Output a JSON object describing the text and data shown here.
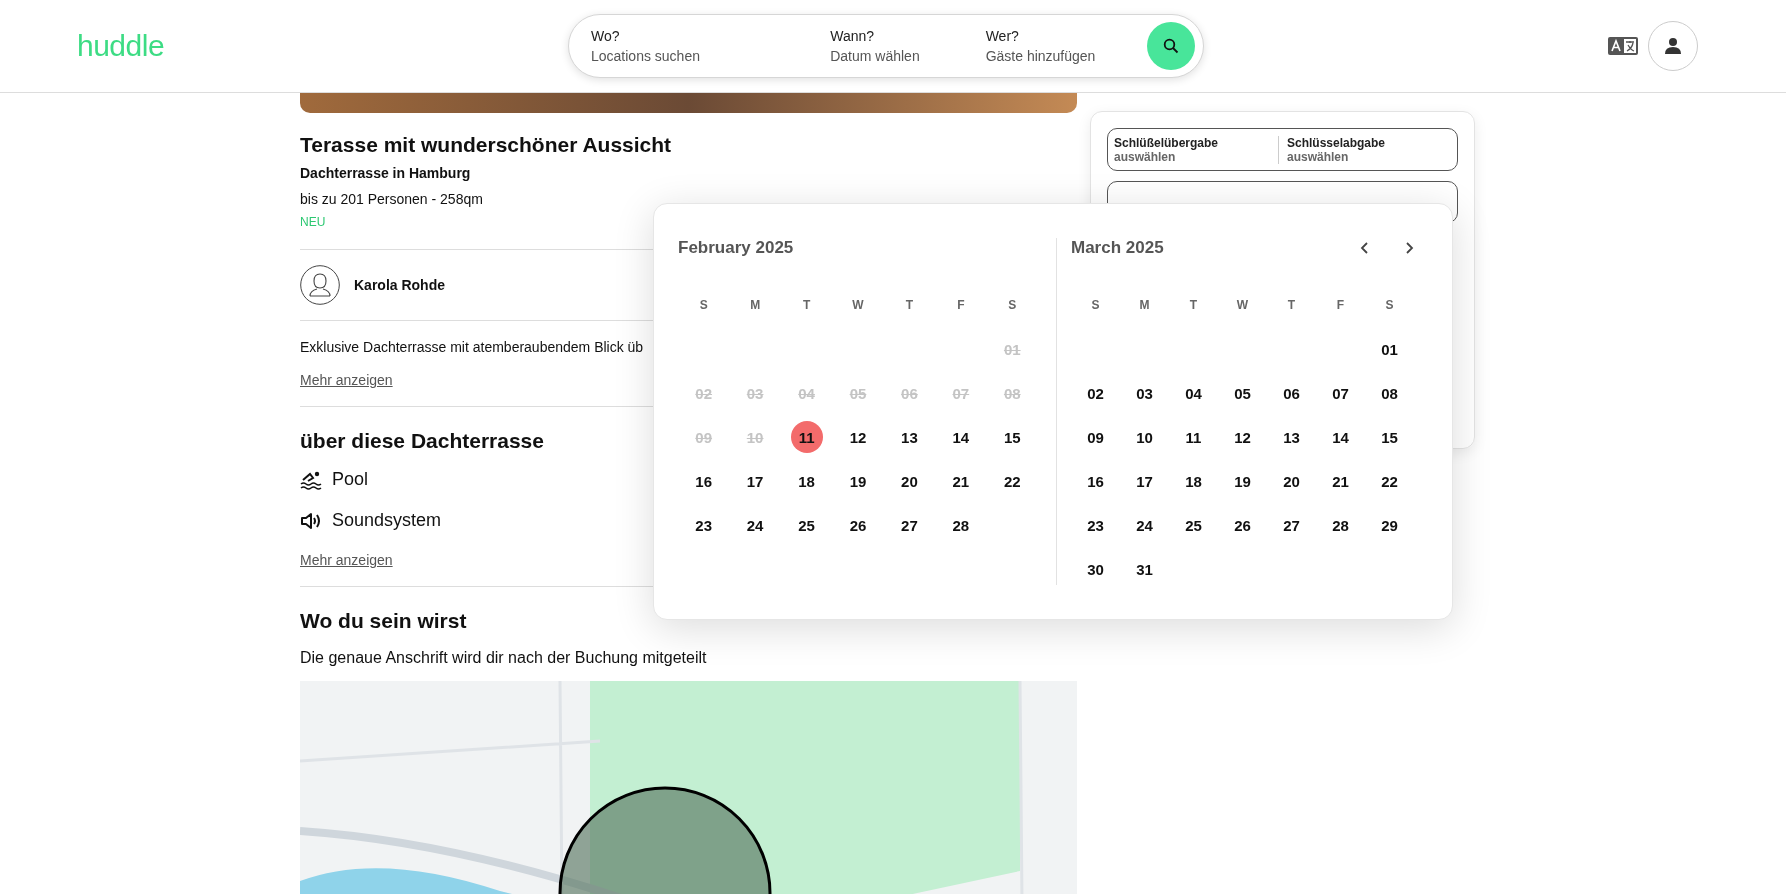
{
  "header": {
    "logo": "huddle",
    "search": [
      {
        "label": "Wo?",
        "placeholder": "Locations suchen"
      },
      {
        "label": "Wann?",
        "placeholder": "Datum wählen"
      },
      {
        "label": "Wer?",
        "placeholder": "Gäste hinzufügen"
      }
    ]
  },
  "listing": {
    "title": "Terasse mit wunderschöner Aussicht",
    "subtitle": "Dachterrasse in Hamburg",
    "capacity": "bis zu 201 Personen - 258qm",
    "badge": "NEU",
    "host": "Karola Rohde",
    "description": "Exklusive Dachterrasse mit atemberaubendem Blick üb",
    "more_1": "Mehr anzeigen",
    "amenities_title": "über diese Dachterrasse",
    "amenities": [
      {
        "kind": "pool",
        "label": "Pool"
      },
      {
        "kind": "sound",
        "label": "Soundsystem"
      }
    ],
    "more_2": "Mehr anzeigen",
    "location_title": "Wo du sein wirst",
    "location_note": "Die genaue Anschrift wird dir nach der Buchung mitgeteilt"
  },
  "booking": {
    "fields": [
      {
        "label": "Schlüßelübergabe",
        "value": "auswählen"
      },
      {
        "label": "Schlüsselabgabe",
        "value": "auswählen"
      }
    ]
  },
  "calendar": {
    "months": [
      {
        "title": "February 2025",
        "weekdays": [
          "S",
          "M",
          "T",
          "W",
          "T",
          "F",
          "S"
        ],
        "weeks": [
          {
            "kind": "trailing",
            "days": [
              {
                "day": "01",
                "disabled": true,
                "selected": false
              }
            ]
          },
          {
            "kind": "full",
            "days": [
              {
                "day": "02",
                "disabled": true,
                "selected": false
              },
              {
                "day": "03",
                "disabled": true,
                "selected": false
              },
              {
                "day": "04",
                "disabled": true,
                "selected": false
              },
              {
                "day": "05",
                "disabled": true,
                "selected": false
              },
              {
                "day": "06",
                "disabled": true,
                "selected": false
              },
              {
                "day": "07",
                "disabled": true,
                "selected": false
              },
              {
                "day": "08",
                "disabled": true,
                "selected": false
              }
            ]
          },
          {
            "kind": "full",
            "days": [
              {
                "day": "09",
                "disabled": true,
                "selected": false
              },
              {
                "day": "10",
                "disabled": true,
                "selected": false
              },
              {
                "day": "11",
                "disabled": false,
                "selected": true
              },
              {
                "day": "12",
                "disabled": false,
                "selected": false
              },
              {
                "day": "13",
                "disabled": false,
                "selected": false
              },
              {
                "day": "14",
                "disabled": false,
                "selected": false
              },
              {
                "day": "15",
                "disabled": false,
                "selected": false
              }
            ]
          },
          {
            "kind": "full",
            "days": [
              {
                "day": "16",
                "disabled": false,
                "selected": false
              },
              {
                "day": "17",
                "disabled": false,
                "selected": false
              },
              {
                "day": "18",
                "disabled": false,
                "selected": false
              },
              {
                "day": "19",
                "disabled": false,
                "selected": false
              },
              {
                "day": "20",
                "disabled": false,
                "selected": false
              },
              {
                "day": "21",
                "disabled": false,
                "selected": false
              },
              {
                "day": "22",
                "disabled": false,
                "selected": false
              }
            ]
          },
          {
            "kind": "full",
            "days": [
              {
                "day": "23",
                "disabled": false,
                "selected": false
              },
              {
                "day": "24",
                "disabled": false,
                "selected": false
              },
              {
                "day": "25",
                "disabled": false,
                "selected": false
              },
              {
                "day": "26",
                "disabled": false,
                "selected": false
              },
              {
                "day": "27",
                "disabled": false,
                "selected": false
              },
              {
                "day": "28",
                "disabled": false,
                "selected": false
              }
            ]
          }
        ]
      },
      {
        "title": "March 2025",
        "weekdays": [
          "S",
          "M",
          "T",
          "W",
          "T",
          "F",
          "S"
        ],
        "weeks": [
          {
            "kind": "trailing",
            "days": [
              {
                "day": "01",
                "disabled": false,
                "selected": false
              }
            ]
          },
          {
            "kind": "full",
            "days": [
              {
                "day": "02",
                "disabled": false,
                "selected": false
              },
              {
                "day": "03",
                "disabled": false,
                "selected": false
              },
              {
                "day": "04",
                "disabled": false,
                "selected": false
              },
              {
                "day": "05",
                "disabled": false,
                "selected": false
              },
              {
                "day": "06",
                "disabled": false,
                "selected": false
              },
              {
                "day": "07",
                "disabled": false,
                "selected": false
              },
              {
                "day": "08",
                "disabled": false,
                "selected": false
              }
            ]
          },
          {
            "kind": "full",
            "days": [
              {
                "day": "09",
                "disabled": false,
                "selected": false
              },
              {
                "day": "10",
                "disabled": false,
                "selected": false
              },
              {
                "day": "11",
                "disabled": false,
                "selected": false
              },
              {
                "day": "12",
                "disabled": false,
                "selected": false
              },
              {
                "day": "13",
                "disabled": false,
                "selected": false
              },
              {
                "day": "14",
                "disabled": false,
                "selected": false
              },
              {
                "day": "15",
                "disabled": false,
                "selected": false
              }
            ]
          },
          {
            "kind": "full",
            "days": [
              {
                "day": "16",
                "disabled": false,
                "selected": false
              },
              {
                "day": "17",
                "disabled": false,
                "selected": false
              },
              {
                "day": "18",
                "disabled": false,
                "selected": false
              },
              {
                "day": "19",
                "disabled": false,
                "selected": false
              },
              {
                "day": "20",
                "disabled": false,
                "selected": false
              },
              {
                "day": "21",
                "disabled": false,
                "selected": false
              },
              {
                "day": "22",
                "disabled": false,
                "selected": false
              }
            ]
          },
          {
            "kind": "full",
            "days": [
              {
                "day": "23",
                "disabled": false,
                "selected": false
              },
              {
                "day": "24",
                "disabled": false,
                "selected": false
              },
              {
                "day": "25",
                "disabled": false,
                "selected": false
              },
              {
                "day": "26",
                "disabled": false,
                "selected": false
              },
              {
                "day": "27",
                "disabled": false,
                "selected": false
              },
              {
                "day": "28",
                "disabled": false,
                "selected": false
              },
              {
                "day": "29",
                "disabled": false,
                "selected": false
              }
            ]
          },
          {
            "kind": "full",
            "days": [
              {
                "day": "30",
                "disabled": false,
                "selected": false
              },
              {
                "day": "31",
                "disabled": false,
                "selected": false
              }
            ]
          }
        ]
      }
    ]
  }
}
